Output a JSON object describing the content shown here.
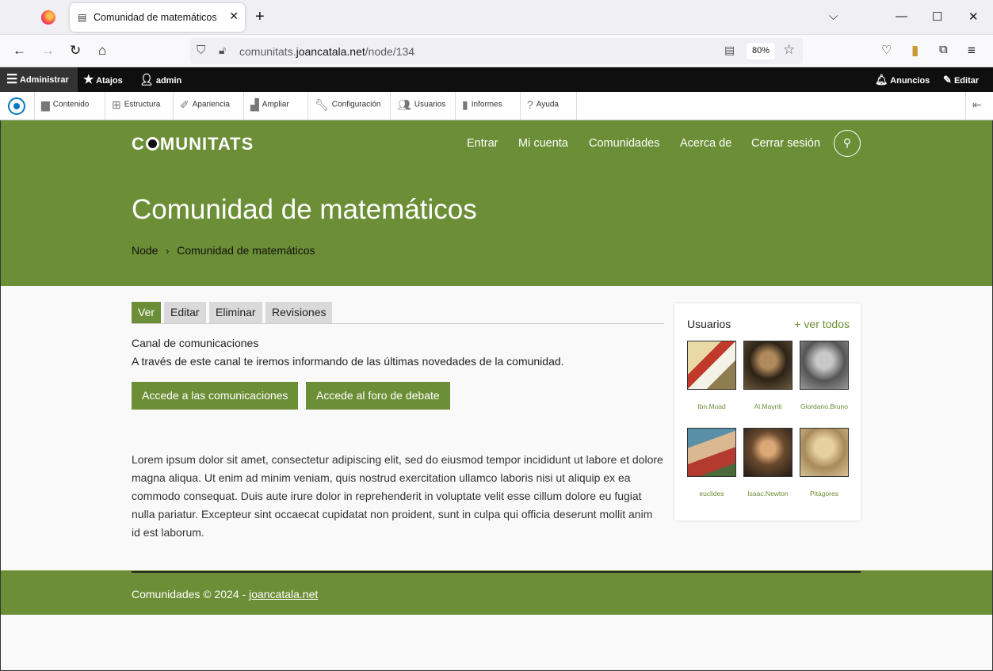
{
  "browser": {
    "tab_title": "Comunidad de matemáticos | C",
    "url_host_prefix": "comunitats.",
    "url_domain": "joancatala.net",
    "url_path": "/node/134",
    "zoom": "80%"
  },
  "admin_toolbar": {
    "administrar": "Administrar",
    "atajos": "Atajos",
    "user": "admin",
    "anuncios": "Anuncios",
    "editar": "Editar"
  },
  "tray": {
    "items": [
      "Contenido",
      "Estructura",
      "Apariencia",
      "Ampliar",
      "Configuración",
      "Usuarios",
      "Informes",
      "Ayuda"
    ]
  },
  "header": {
    "logo_pre": "C",
    "logo_post": "MUNITATS",
    "menu": [
      "Entrar",
      "Mi cuenta",
      "Comunidades",
      "Acerca de",
      "Cerrar sesión"
    ],
    "title": "Comunidad de matemáticos",
    "breadcrumb": [
      "Node",
      "Comunidad de matemáticos"
    ]
  },
  "content": {
    "tabs": [
      "Ver",
      "Editar",
      "Eliminar",
      "Revisiones"
    ],
    "channel_title": "Canal de comunicaciones",
    "channel_desc": "A través de este canal te iremos informando de las últimas novedades de la comunidad.",
    "btn_comms": "Accede a las comunicaciones",
    "btn_forum": "Accede al foro de debate",
    "lorem": "Lorem ipsum dolor sit amet, consectetur adipiscing elit, sed do eiusmod tempor incididunt ut labore et dolore magna aliqua. Ut enim ad minim veniam, quis nostrud exercitation ullamco laboris nisi ut aliquip ex ea commodo consequat. Duis aute irure dolor in reprehenderit in voluptate velit esse cillum dolore eu fugiat nulla pariatur. Excepteur sint occaecat cupidatat non proident, sunt in culpa qui officia deserunt mollit anim id est laborum."
  },
  "sidebar": {
    "title": "Usuarios",
    "see_all": "+ ver todos",
    "users": [
      "Ibn.Muad",
      "Al.Mayriti",
      "Giordano.Bruno",
      "euclides",
      "Isaac.Newton",
      "Pitágores"
    ]
  },
  "footer": {
    "text": "Comunidades © 2024 - ",
    "link": "joancatala.net"
  },
  "colors": {
    "brand_green": "#6b8e36"
  }
}
